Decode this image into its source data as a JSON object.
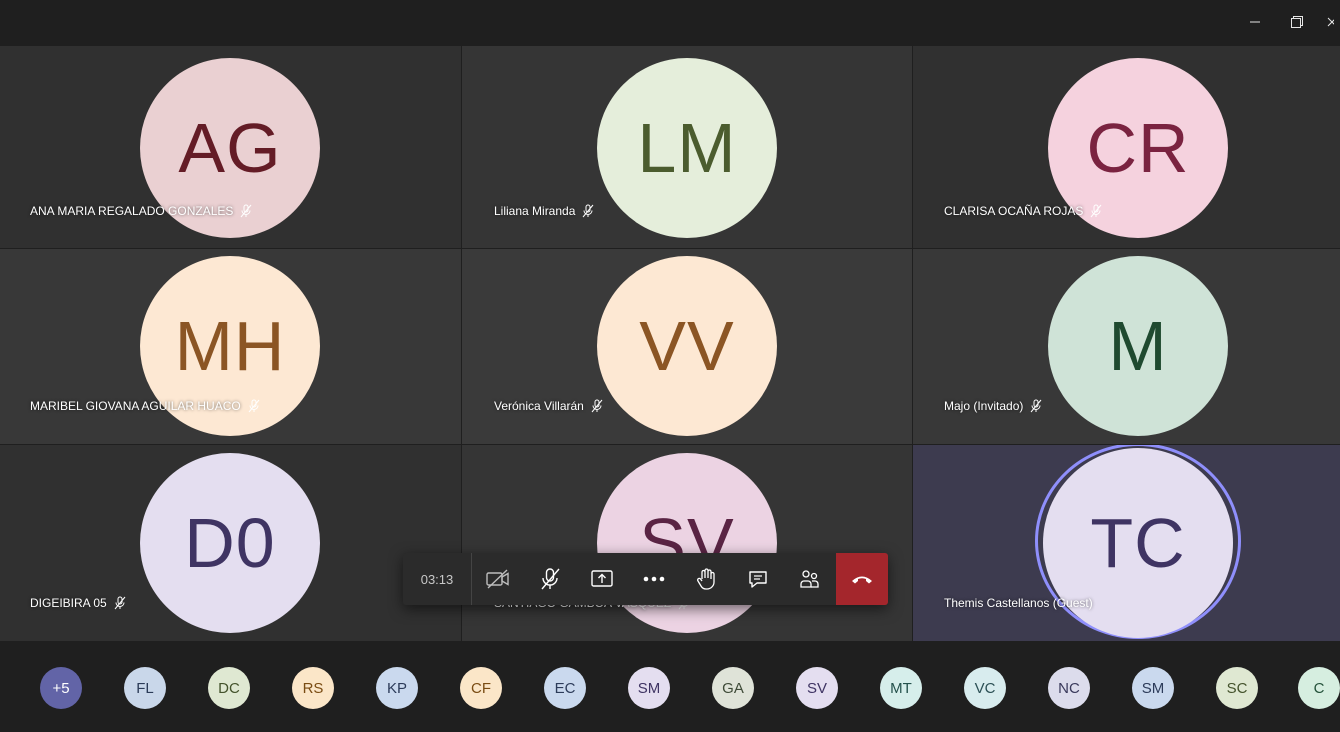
{
  "window": {
    "minimize_icon": "minimize-icon",
    "restore_icon": "restore-icon",
    "close_icon": "close-icon"
  },
  "participants": [
    {
      "initials": "AG",
      "name": "ANA MARIA REGALADO GONZALES",
      "avatar_bg": "#ead0d2",
      "avatar_fg": "#641c26",
      "muted": true
    },
    {
      "initials": "LM",
      "name": "Liliana Miranda",
      "avatar_bg": "#e5eedb",
      "avatar_fg": "#4b5c2e",
      "muted": true
    },
    {
      "initials": "CR",
      "name": "CLARISA OCAÑA ROJAS",
      "avatar_bg": "#f5d2de",
      "avatar_fg": "#7a2340",
      "muted": true
    },
    {
      "initials": "MH",
      "name": "MARIBEL GIOVANA AGUILAR HUACO",
      "avatar_bg": "#fde8d3",
      "avatar_fg": "#8b5524",
      "muted": true
    },
    {
      "initials": "VV",
      "name": "Verónica Villarán",
      "avatar_bg": "#fde8d3",
      "avatar_fg": "#8b5524",
      "muted": true
    },
    {
      "initials": "M",
      "name": "Majo (Invitado)",
      "avatar_bg": "#cfe3d7",
      "avatar_fg": "#1f4a30",
      "muted": true
    },
    {
      "initials": "D0",
      "name": "DIGEIBIRA 05",
      "avatar_bg": "#e4def0",
      "avatar_fg": "#3f3463",
      "muted": true
    },
    {
      "initials": "SV",
      "name": "SANTIAGO GAMBOA VASQUEZ",
      "avatar_bg": "#ecd3e3",
      "avatar_fg": "#5a2444",
      "muted": true
    },
    {
      "initials": "TC",
      "name": "Themis Castellanos (Guest)",
      "avatar_bg": "#e4def0",
      "avatar_fg": "#3f3463",
      "muted": false,
      "speaking": true
    }
  ],
  "toolbar": {
    "timer": "03:13",
    "buttons": [
      {
        "name": "camera-off-button",
        "icon": "camera-off-icon"
      },
      {
        "name": "mic-off-button",
        "icon": "mic-off-icon"
      },
      {
        "name": "share-screen-button",
        "icon": "share-screen-icon"
      },
      {
        "name": "more-actions-button",
        "icon": "more-icon"
      },
      {
        "name": "raise-hand-button",
        "icon": "hand-icon"
      },
      {
        "name": "chat-button",
        "icon": "chat-icon"
      },
      {
        "name": "participants-button",
        "icon": "people-icon"
      }
    ],
    "hangup": {
      "name": "hang-up-button",
      "icon": "phone-hangup-icon",
      "color": "#a4262c"
    }
  },
  "overflow": [
    {
      "label": "+5",
      "bg": "#6264a7",
      "fg": "#ffffff"
    },
    {
      "label": "FL",
      "bg": "#c9d7ea",
      "fg": "#2b3b58"
    },
    {
      "label": "DC",
      "bg": "#dfe8d2",
      "fg": "#44532c"
    },
    {
      "label": "RS",
      "bg": "#fbe6c8",
      "fg": "#7a4c13"
    },
    {
      "label": "KP",
      "bg": "#cad9ee",
      "fg": "#2d3c5a"
    },
    {
      "label": "CF",
      "bg": "#fbe6c8",
      "fg": "#7a4c13"
    },
    {
      "label": "EC",
      "bg": "#cad9ee",
      "fg": "#2d3c5a"
    },
    {
      "label": "SM",
      "bg": "#e4def0",
      "fg": "#3f3463"
    },
    {
      "label": "GA",
      "bg": "#dfe3d8",
      "fg": "#3e4a37"
    },
    {
      "label": "SV",
      "bg": "#e4def0",
      "fg": "#3f3463"
    },
    {
      "label": "MT",
      "bg": "#d6eeeb",
      "fg": "#24514c"
    },
    {
      "label": "VC",
      "bg": "#d8ecee",
      "fg": "#2c5055"
    },
    {
      "label": "NC",
      "bg": "#dcdcec",
      "fg": "#3a3a5c"
    },
    {
      "label": "SM",
      "bg": "#cad9ee",
      "fg": "#2d3c5a"
    },
    {
      "label": "SC",
      "bg": "#dfe8d2",
      "fg": "#44532c"
    },
    {
      "label": "C",
      "bg": "#d6eee0",
      "fg": "#24513a"
    }
  ]
}
